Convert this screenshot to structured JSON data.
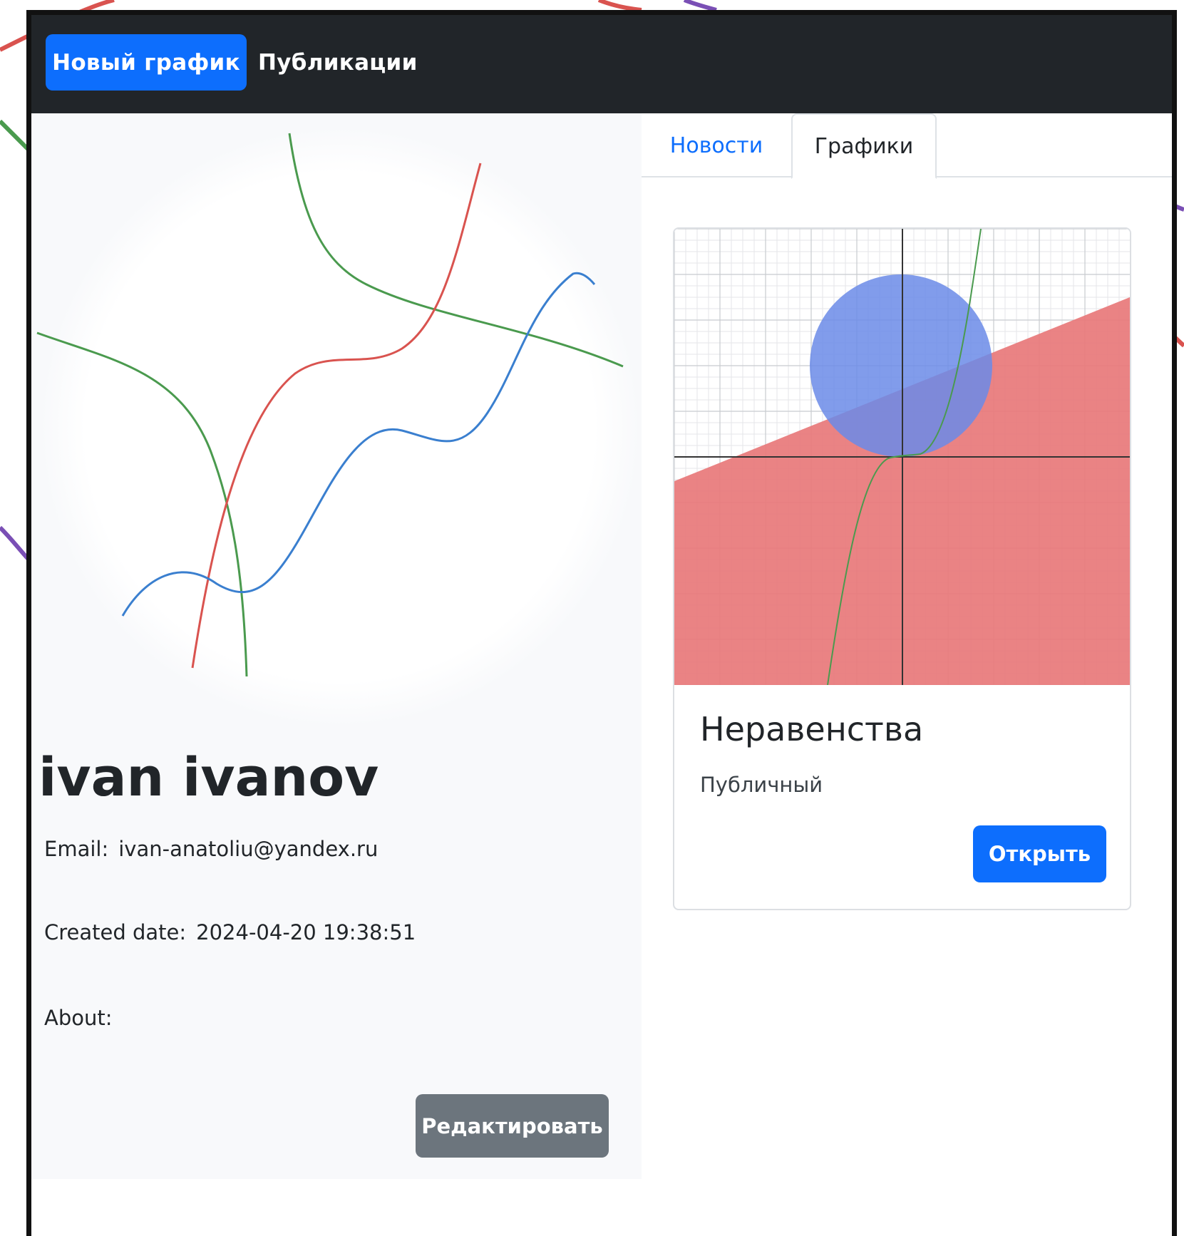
{
  "navbar": {
    "new_graph_label": "Новый график",
    "publications_label": "Публикации"
  },
  "profile": {
    "name": "ivan ivanov",
    "email_label": "Email:",
    "email_value": "ivan-anatoliu@yandex.ru",
    "created_label": "Created date:",
    "created_value": "2024-04-20 19:38:51",
    "about_label": "About:",
    "about_value": "",
    "edit_label": "Редактировать"
  },
  "tabs": [
    {
      "label": "Новости",
      "active": false
    },
    {
      "label": "Графики",
      "active": true
    }
  ],
  "graph_card": {
    "title": "Неравенства",
    "visibility": "Публичный",
    "open_label": "Открыть"
  },
  "colors": {
    "navbar": "#212529",
    "primary": "#0d6efd",
    "secondary": "#6c757d",
    "curve_green": "#4a9a4e",
    "curve_red": "#d9534f",
    "curve_blue": "#3a7fcf",
    "inequality_fill": "#e8787a",
    "circle_fill": "#6b8be8"
  }
}
